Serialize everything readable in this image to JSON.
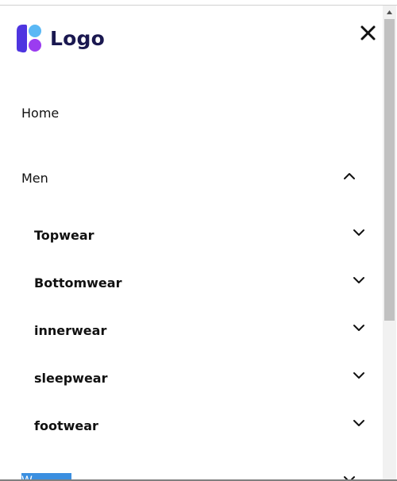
{
  "logo": {
    "text": "Logo",
    "mark_colors": [
      "#4e35e0",
      "#5ab8f5",
      "#9b3cf0"
    ]
  },
  "nav": {
    "home": "Home",
    "men": "Men",
    "men_sub": [
      "Topwear",
      "Bottomwear",
      "innerwear",
      "sleepwear",
      "footwear"
    ],
    "next_partial": "W"
  },
  "icons": {
    "close": "close-icon",
    "collapse": "chevron-up-icon",
    "expand": "chevron-down-icon"
  },
  "colors": {
    "accent": "#3b8fe0",
    "logo_text": "#1a1850"
  }
}
